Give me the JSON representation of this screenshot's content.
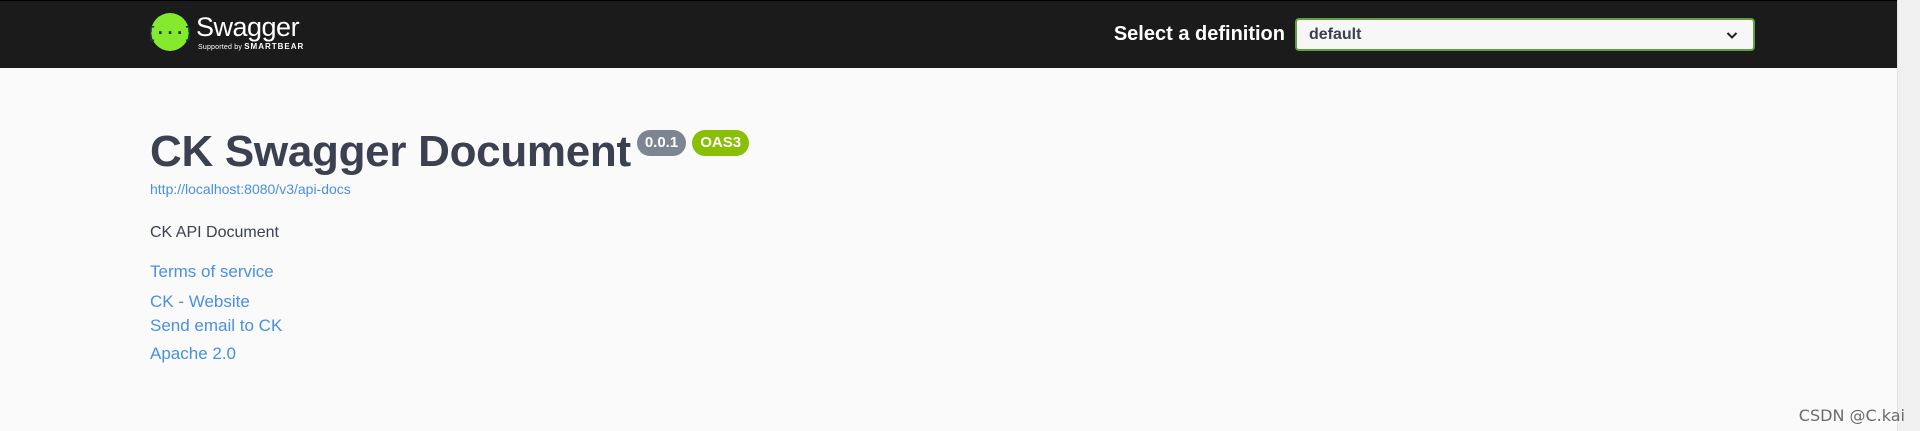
{
  "topbar": {
    "brand_name": "Swagger",
    "brand_tagline_prefix": "Supported by",
    "brand_tagline_company": "SMARTBEAR",
    "definition_label": "Select a definition",
    "definition_selected": "default"
  },
  "info": {
    "title": "CK Swagger Document",
    "version_badge": "0.0.1",
    "spec_badge": "OAS3",
    "url": "http://localhost:8080/v3/api-docs",
    "description": "CK API Document",
    "links": {
      "terms": "Terms of service",
      "website": "CK - Website",
      "email": "Send email to CK",
      "license": "Apache 2.0"
    }
  },
  "watermark": "CSDN @C.kai",
  "colors": {
    "topbar_bg": "#1b1b1b",
    "brand_green": "#85ea2d",
    "link_blue": "#4990e2",
    "badge_gray": "#7d8492",
    "badge_green": "#89bf04",
    "select_border": "#62a03f"
  },
  "icons": {
    "logo": "swagger-logo-icon",
    "dropdown": "chevron-down-icon"
  }
}
